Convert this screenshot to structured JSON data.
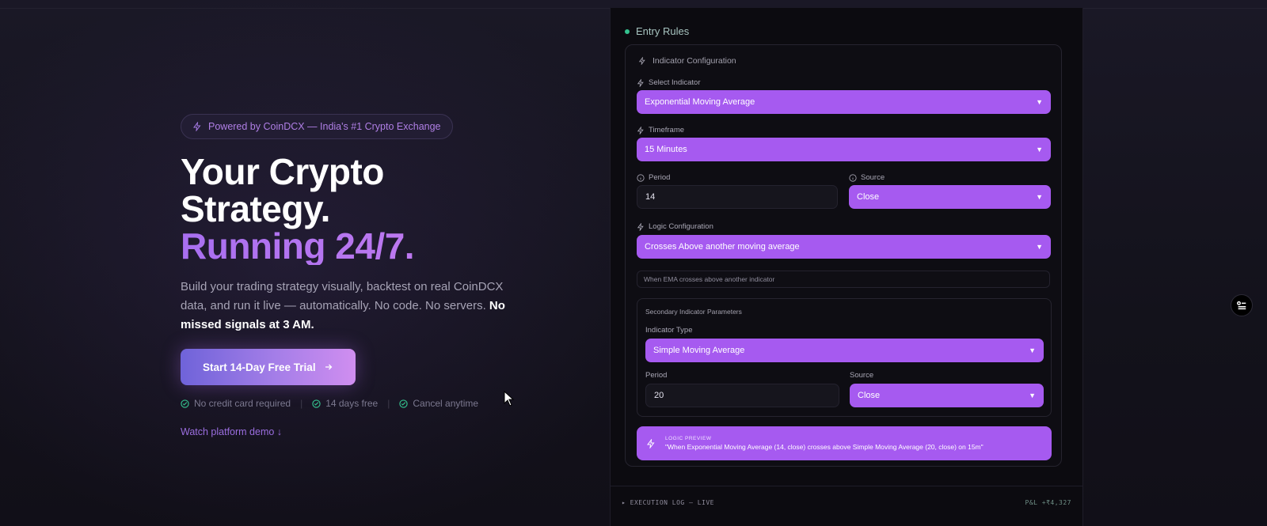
{
  "hero": {
    "badge": "Powered by CoinDCX — India's #1 Crypto Exchange",
    "title_line1": "Your Crypto",
    "title_line2": "Strategy.",
    "title_accent": "Running 24/7.",
    "description": "Build your trading strategy visually, backtest on real CoinDCX data, and run it live — automatically. No code. No servers.",
    "description_bold": "No missed signals at 3 AM.",
    "cta_label": "Start 14-Day Free Trial",
    "perks": [
      "No credit card required",
      "14 days free",
      "Cancel anytime"
    ],
    "demo_link": "Watch platform demo ↓"
  },
  "panel": {
    "title": "Entry Rules",
    "card_title": "Indicator Configuration",
    "select_indicator_label": "Select Indicator",
    "select_indicator_value": "Exponential Moving Average",
    "timeframe_label": "Timeframe",
    "timeframe_value": "15 Minutes",
    "period_label": "Period",
    "period_value": "14",
    "source_label": "Source",
    "source_value": "Close",
    "logic_label": "Logic Configuration",
    "logic_value": "Crosses Above another moving average",
    "logic_hint": "When EMA crosses above another indicator",
    "secondary": {
      "title": "Secondary Indicator Parameters",
      "type_label": "Indicator Type",
      "type_value": "Simple Moving Average",
      "period_label": "Period",
      "period_value": "20",
      "source_label": "Source",
      "source_value": "Close"
    },
    "preview_heading": "LOGIC PREVIEW",
    "preview_text": "\"When Exponential Moving Average (14, close) crosses above Simple Moving Average (20, close) on 15m\"",
    "exec_label": "▸ EXECUTION LOG — LIVE",
    "pnl_label": "P&L +₹4,327"
  },
  "colors": {
    "accent": "#a65af0",
    "background": "#14131d",
    "panel": "#0c0b10",
    "live_dot": "#34c38f"
  },
  "icons": [
    "lightning-icon",
    "check-circle-icon",
    "info-icon",
    "arrow-right-icon",
    "chevron-down-icon",
    "settings-list-icon",
    "mouse-cursor-icon"
  ]
}
